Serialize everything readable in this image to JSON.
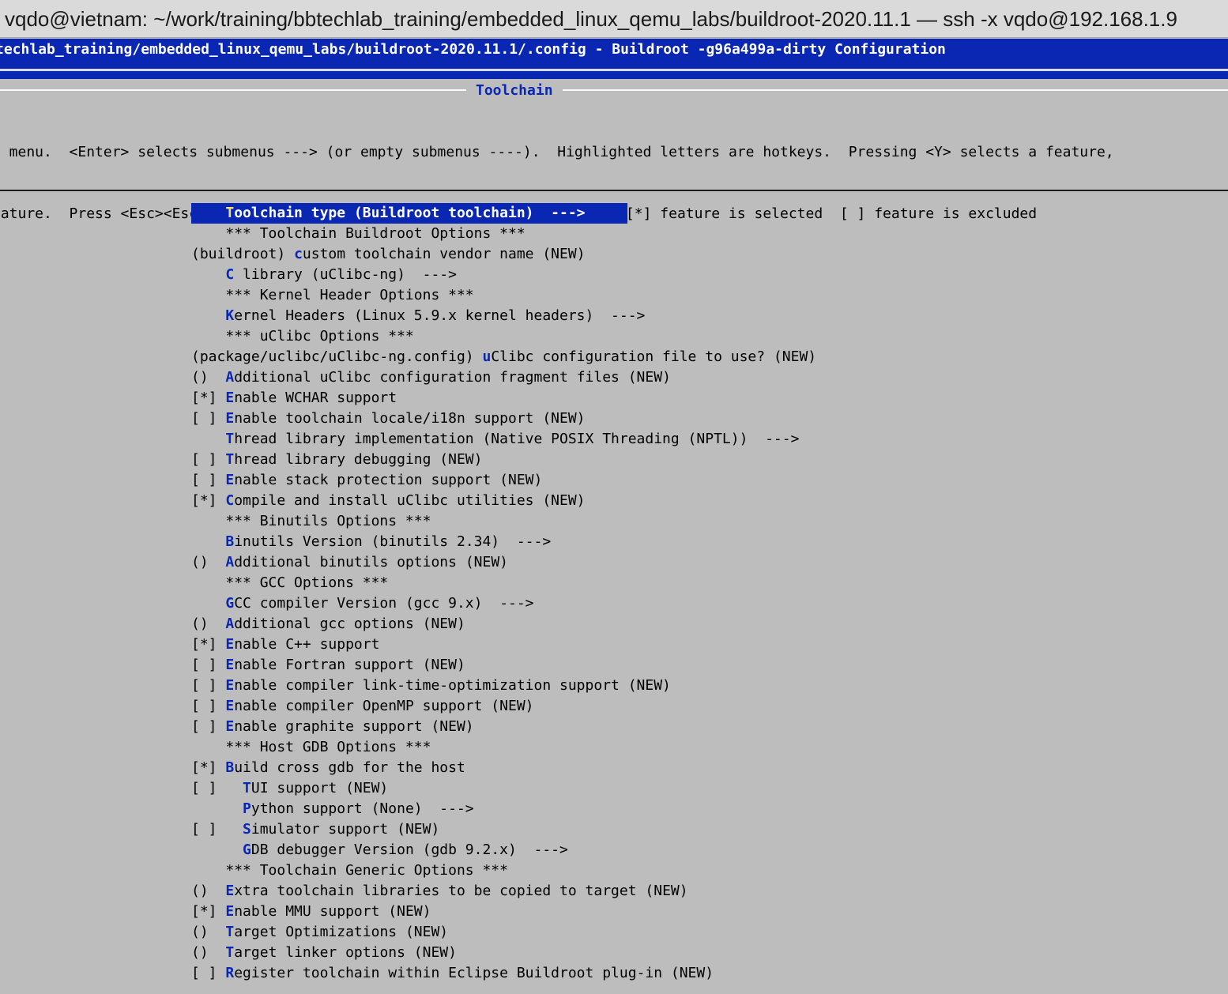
{
  "window": {
    "title": "vqdo@vietnam: ~/work/training/bbtechlab_training/embedded_linux_qemu_labs/buildroot-2020.11.1 — ssh -x vqdo@192.168.1.9"
  },
  "config_bar": {
    "title": "techlab_training/embedded_linux_qemu_labs/buildroot-2020.11.1/.config - Buildroot -g96a499a-dirty Configuration"
  },
  "dialog": {
    "title": "Toolchain",
    "help_line1": "e menu.  <Enter> selects submenus ---> (or empty submenus ----).  Highlighted letters are hotkeys.  Pressing <Y> selects a feature,",
    "help_line2": "eature.  Press <Esc><Esc> to exit, <?> for Help, </> for Search.  Legend: [*] feature is selected  [ ] feature is excluded"
  },
  "menu": {
    "items": [
      {
        "mark": "",
        "indent": "    ",
        "hotkey": "T",
        "label": "oolchain type (Buildroot toolchain)  --->",
        "selected": true
      },
      {
        "mark": "",
        "indent": "    ",
        "hotkey": "",
        "label": "*** Toolchain Buildroot Options ***"
      },
      {
        "mark": "(buildroot)",
        "indent": " ",
        "hotkey": "c",
        "label": "ustom toolchain vendor name (NEW)"
      },
      {
        "mark": "",
        "indent": "    ",
        "hotkey": "C",
        "label": " library (uClibc-ng)  --->"
      },
      {
        "mark": "",
        "indent": "    ",
        "hotkey": "",
        "label": "*** Kernel Header Options ***"
      },
      {
        "mark": "",
        "indent": "    ",
        "hotkey": "K",
        "label": "ernel Headers (Linux 5.9.x kernel headers)  --->"
      },
      {
        "mark": "",
        "indent": "    ",
        "hotkey": "",
        "label": "*** uClibc Options ***"
      },
      {
        "mark": "(package/uclibc/uClibc-ng.config)",
        "indent": " ",
        "hotkey": "u",
        "label": "Clibc configuration file to use? (NEW)"
      },
      {
        "mark": "()",
        "indent": "  ",
        "hotkey": "A",
        "label": "dditional uClibc configuration fragment files (NEW)"
      },
      {
        "mark": "[*]",
        "indent": " ",
        "hotkey": "E",
        "label": "nable WCHAR support"
      },
      {
        "mark": "[ ]",
        "indent": " ",
        "hotkey": "E",
        "label": "nable toolchain locale/i18n support (NEW)"
      },
      {
        "mark": "",
        "indent": "    ",
        "hotkey": "T",
        "label": "hread library implementation (Native POSIX Threading (NPTL))  --->"
      },
      {
        "mark": "[ ]",
        "indent": " ",
        "hotkey": "T",
        "label": "hread library debugging (NEW)"
      },
      {
        "mark": "[ ]",
        "indent": " ",
        "hotkey": "E",
        "label": "nable stack protection support (NEW)"
      },
      {
        "mark": "[*]",
        "indent": " ",
        "hotkey": "C",
        "label": "ompile and install uClibc utilities (NEW)"
      },
      {
        "mark": "",
        "indent": "    ",
        "hotkey": "",
        "label": "*** Binutils Options ***"
      },
      {
        "mark": "",
        "indent": "    ",
        "hotkey": "B",
        "label": "inutils Version (binutils 2.34)  --->"
      },
      {
        "mark": "()",
        "indent": "  ",
        "hotkey": "A",
        "label": "dditional binutils options (NEW)"
      },
      {
        "mark": "",
        "indent": "    ",
        "hotkey": "",
        "label": "*** GCC Options ***"
      },
      {
        "mark": "",
        "indent": "    ",
        "hotkey": "G",
        "label": "CC compiler Version (gcc 9.x)  --->"
      },
      {
        "mark": "()",
        "indent": "  ",
        "hotkey": "A",
        "label": "dditional gcc options (NEW)"
      },
      {
        "mark": "[*]",
        "indent": " ",
        "hotkey": "E",
        "label": "nable C++ support"
      },
      {
        "mark": "[ ]",
        "indent": " ",
        "hotkey": "E",
        "label": "nable Fortran support (NEW)"
      },
      {
        "mark": "[ ]",
        "indent": " ",
        "hotkey": "E",
        "label": "nable compiler link-time-optimization support (NEW)"
      },
      {
        "mark": "[ ]",
        "indent": " ",
        "hotkey": "E",
        "label": "nable compiler OpenMP support (NEW)"
      },
      {
        "mark": "[ ]",
        "indent": " ",
        "hotkey": "E",
        "label": "nable graphite support (NEW)"
      },
      {
        "mark": "",
        "indent": "    ",
        "hotkey": "",
        "label": "*** Host GDB Options ***"
      },
      {
        "mark": "[*]",
        "indent": " ",
        "hotkey": "B",
        "label": "uild cross gdb for the host"
      },
      {
        "mark": "[ ]",
        "indent": "   ",
        "hotkey": "T",
        "label": "UI support (NEW)"
      },
      {
        "mark": "",
        "indent": "      ",
        "hotkey": "P",
        "label": "ython support (None)  --->"
      },
      {
        "mark": "[ ]",
        "indent": "   ",
        "hotkey": "S",
        "label": "imulator support (NEW)"
      },
      {
        "mark": "",
        "indent": "      ",
        "hotkey": "G",
        "label": "DB debugger Version (gdb 9.2.x)  --->"
      },
      {
        "mark": "",
        "indent": "    ",
        "hotkey": "",
        "label": "*** Toolchain Generic Options ***"
      },
      {
        "mark": "()",
        "indent": "  ",
        "hotkey": "E",
        "label": "xtra toolchain libraries to be copied to target (NEW)"
      },
      {
        "mark": "[*]",
        "indent": " ",
        "hotkey": "E",
        "label": "nable MMU support (NEW)"
      },
      {
        "mark": "()",
        "indent": "  ",
        "hotkey": "T",
        "label": "arget Optimizations (NEW)"
      },
      {
        "mark": "()",
        "indent": "  ",
        "hotkey": "T",
        "label": "arget linker options (NEW)"
      },
      {
        "mark": "[ ]",
        "indent": " ",
        "hotkey": "R",
        "label": "egister toolchain within Eclipse Buildroot plug-in (NEW)"
      }
    ]
  }
}
